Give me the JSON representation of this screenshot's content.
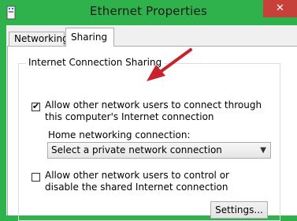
{
  "window": {
    "title": "Ethernet Properties",
    "close_label": "✕"
  },
  "tabs": [
    {
      "label": "Networking",
      "active": false
    },
    {
      "label": "Sharing",
      "active": true
    }
  ],
  "sharing": {
    "group_title": "Internet Connection Sharing",
    "allow_connect": {
      "checked": true,
      "label": "Allow other network users to connect through this computer's Internet connection"
    },
    "home_connection": {
      "label": "Home networking connection:",
      "value": "Select a private network connection"
    },
    "allow_control": {
      "checked": false,
      "label": "Allow other network users to control or disable the shared Internet connection"
    },
    "settings_button": "Settings..."
  },
  "annotation": {
    "arrow_color": "#c8232c"
  },
  "colors": {
    "titlebar": "#2fb24c",
    "close": "#c7403a"
  }
}
